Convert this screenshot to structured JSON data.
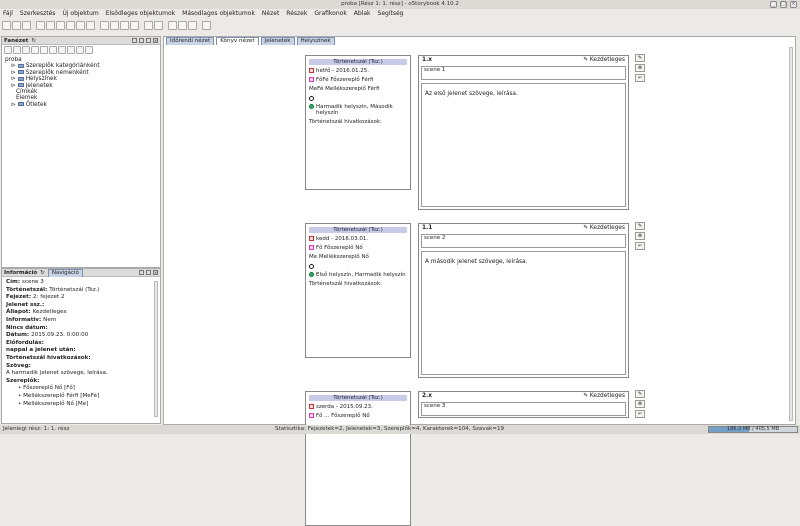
{
  "window": {
    "title": "proba [Rész 1: 1. rész] - oStorybook 4.10.2"
  },
  "menu": [
    "Fájl",
    "Szerkesztés",
    "Új objektum",
    "Elsődleges objektumok",
    "Másodlagos objektumok",
    "Nézet",
    "Részek",
    "Grafikonok",
    "Ablak",
    "Segítség"
  ],
  "left_top": {
    "title": "Fanézet",
    "tree": [
      {
        "label": "proba",
        "level": 0
      },
      {
        "label": "Szereplők kategóriánként",
        "level": 1
      },
      {
        "label": "Szereplők nemenként",
        "level": 1
      },
      {
        "label": "Helyszínek",
        "level": 1
      },
      {
        "label": "Jelenetek",
        "level": 1
      },
      {
        "label": "Címkék",
        "level": 2
      },
      {
        "label": "Elemek",
        "level": 2
      },
      {
        "label": "Ötletek",
        "level": 1
      }
    ]
  },
  "left_bottom": {
    "tabs": [
      "Információ",
      "Navigáció"
    ],
    "info": [
      {
        "k": "Cím",
        "v": "scene 3"
      },
      {
        "k": "Történetszál",
        "v": "Történetszál (Tsz.)"
      },
      {
        "k": "Fejezet",
        "v": "2: fejezet 2"
      },
      {
        "k": "Jelenet ssz.",
        "v": ""
      },
      {
        "k": "Állapot",
        "v": "Kezdetleges"
      },
      {
        "k": "Informativ",
        "v": "Nem"
      },
      {
        "k": "Nincs dátum",
        "v": ""
      },
      {
        "k": "Dátum",
        "v": "2015.09.23. 0:00:00"
      },
      {
        "k": "Előfordulás",
        "v": ""
      },
      {
        "k": "nappal a jelenet után",
        "v": ""
      },
      {
        "k": "Történetszál hivatkozások",
        "v": ""
      },
      {
        "k": "Szöveg",
        "v": ""
      },
      {
        "k": "",
        "v": "A harmadik jelenet szövege, leírása."
      },
      {
        "k": "Szereplők",
        "v": ""
      },
      {
        "k": "",
        "v": "• Főszereplő Nő [Fő]"
      },
      {
        "k": "",
        "v": "• Mellékszereplő Férfi [MeFé]"
      },
      {
        "k": "",
        "v": "• Mellékszereplő Nő [Me]"
      }
    ]
  },
  "center": {
    "tabs": [
      "Időrendi nézet",
      "Könyv nézet",
      "Jelenetek",
      "Helyszínek"
    ],
    "cards": [
      {
        "thread": "Történetszál (Tsz.)",
        "date": "hétfő - 2016.01.25.",
        "person1": "FőFé  Főszereplő Férfi",
        "person2": "MeFé  Mellékszereplő Férfi",
        "location": "Harmadik helyszín, Második helyszín",
        "links": "Történetszál hivatkozások:"
      },
      {
        "thread": "Történetszál (Tsz.)",
        "date": "kedd - 2016.03.01.",
        "person1": "Fő  Főszereplő Nő",
        "person2": "Me  Mellékszereplő Nő",
        "location": "Első helyszín, Harmadik helyszín",
        "links": "Történetszál hivatkozások:"
      },
      {
        "thread": "Történetszál (Tsz.)",
        "date": "szerda - 2015.09.23.",
        "person1": "Fő ... Főszereplő Nő",
        "person2": "",
        "location": "",
        "links": ""
      }
    ],
    "scenes": [
      {
        "number": "1.x",
        "status": "Kezdetleges",
        "name": "scene 1",
        "text": "Az első jelenet szövege, leírása."
      },
      {
        "number": "1.1",
        "status": "Kezdetleges",
        "name": "scene 2",
        "text": "A második jelenet szövege, leírása."
      },
      {
        "number": "2.x",
        "status": "Kezdetleges",
        "name": "scene 3",
        "text": ""
      }
    ]
  },
  "status": {
    "left": "Jelenlegi rész: 1: 1. rész",
    "stats": "Statisztika: Fejezetek=2,  Jelenetek=3,  Szereplők=4,  Karakterek=104,  Szavak=19",
    "memory": "186,3 MB / 405,5 MB",
    "memory_fraction": 0.46
  }
}
